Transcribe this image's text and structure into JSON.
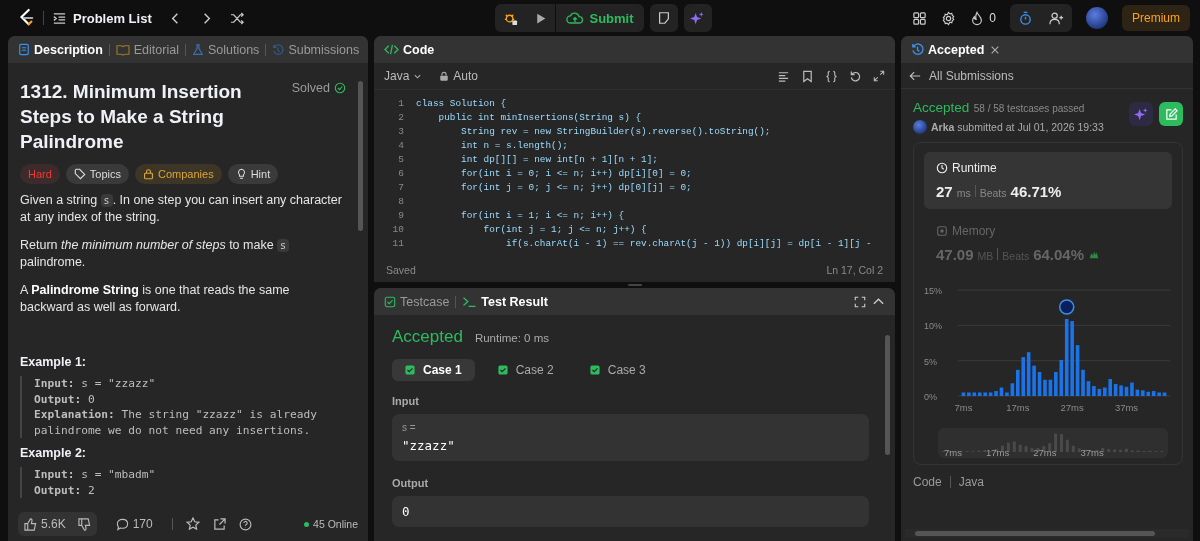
{
  "topbar": {
    "title": "Problem List",
    "submit": "Submit",
    "streak": "0",
    "premium": "Premium"
  },
  "description_panel": {
    "tabs": [
      {
        "label": "Description",
        "selected": true,
        "kind": "description"
      },
      {
        "label": "Editorial",
        "selected": false,
        "kind": "editorial"
      },
      {
        "label": "Solutions",
        "selected": false,
        "kind": "solutions"
      },
      {
        "label": "Submissions",
        "selected": false,
        "kind": "submissions"
      }
    ],
    "title": "1312. Minimum Insertion Steps to Make a String Palindrome",
    "status": "Solved",
    "tags": [
      {
        "label": "Hard",
        "kind": "difficulty"
      },
      {
        "label": "Topics",
        "kind": "topics"
      },
      {
        "label": "Companies",
        "kind": "companies"
      },
      {
        "label": "Hint",
        "kind": "hint"
      }
    ],
    "paragraphs": [
      [
        {
          "kind": "text",
          "text": "Given a string "
        },
        {
          "kind": "code",
          "text": "s"
        },
        {
          "kind": "text",
          "text": ". In one step you can insert any character at any index of the string."
        }
      ],
      [
        {
          "kind": "text",
          "text": "Return "
        },
        {
          "kind": "italic",
          "text": "the minimum number of steps"
        },
        {
          "kind": "text",
          "text": " to make "
        },
        {
          "kind": "code",
          "text": "s"
        },
        {
          "kind": "text",
          "text": " palindrome."
        }
      ],
      [
        {
          "kind": "text",
          "text": "A "
        },
        {
          "kind": "bold",
          "text": "Palindrome String"
        },
        {
          "kind": "text",
          "text": " is one that reads the same backward as well as forward."
        }
      ]
    ],
    "examples": [
      {
        "title": "Example 1:",
        "lines": [
          "**Input:** s = \"zzazz\"",
          "**Output:** 0",
          "**Explanation:** The string \"zzazz\" is already palindrome we do not need any insertions."
        ]
      },
      {
        "title": "Example 2:",
        "lines": [
          "**Input:** s = \"mbadm\"",
          "**Output:** 2"
        ]
      }
    ],
    "footer": {
      "likes": "5.6K",
      "comments": "170",
      "online": "45 Online"
    }
  },
  "code_panel": {
    "title": "Code",
    "language": "Java",
    "mode": "Auto",
    "lines": [
      {
        "number": "1",
        "text": "class Solution {"
      },
      {
        "number": "2",
        "text": "    public int minInsertions(String s) {"
      },
      {
        "number": "3",
        "text": "        String rev = new StringBuilder(s).reverse().toString();"
      },
      {
        "number": "4",
        "text": "        int n = s.length();"
      },
      {
        "number": "5",
        "text": "        int dp[][] = new int[n + 1][n + 1];"
      },
      {
        "number": "6",
        "text": "        for(int i = 0; i <= n; i++) dp[i][0] = 0;"
      },
      {
        "number": "7",
        "text": "        for(int j = 0; j <= n; j++) dp[0][j] = 0;"
      },
      {
        "number": "8"
      },
      {
        "number": "9",
        "text": "        for(int i = 1; i <= n; i++) {"
      },
      {
        "number": "10",
        "text": "            for(int j = 1; j <= n; j++) {"
      },
      {
        "number": "11",
        "text": "                if(s.charAt(i - 1) == rev.charAt(j - 1)) dp[i][j] = dp[i - 1][j -"
      }
    ],
    "status": "Saved",
    "cursor": "Ln 17, Col 2"
  },
  "test_panel": {
    "tabs": [
      {
        "label": "Testcase",
        "selected": false
      },
      {
        "label": "Test Result",
        "selected": true
      }
    ],
    "result": "Accepted",
    "runtime": "Runtime: 0 ms",
    "cases": [
      {
        "label": "Case 1",
        "selected": true
      },
      {
        "label": "Case 2",
        "selected": false
      },
      {
        "label": "Case 3",
        "selected": false
      }
    ],
    "input": {
      "label": "Input",
      "name": "s =",
      "value": "\"zzazz\""
    },
    "output": {
      "label": "Output",
      "value": "0"
    }
  },
  "submission_panel": {
    "tab": "Accepted",
    "back": "All Submissions",
    "status": "Accepted",
    "passed": "58 / 58 testcases passed",
    "submitted": "**Arka** submitted at Jul 01, 2026 19:33",
    "metrics": [
      {
        "label": "Runtime",
        "kind": "runtime",
        "value": "27",
        "unit": "ms",
        "beats_label": "Beats",
        "beats": "46.71%",
        "selected": true
      },
      {
        "label": "Memory",
        "kind": "memory",
        "value": "47.09",
        "unit": "MB",
        "beats_label": "Beats",
        "beats": "64.04%",
        "selected": false
      }
    ],
    "chart_data": {
      "type": "bar",
      "x": [
        7,
        8,
        9,
        10,
        11,
        12,
        13,
        14,
        15,
        16,
        17,
        18,
        19,
        20,
        21,
        22,
        23,
        24,
        25,
        26,
        27,
        28,
        29,
        30,
        31,
        32,
        33,
        34,
        35,
        36,
        37,
        38,
        39,
        40,
        41,
        42,
        43,
        44
      ],
      "values": [
        0.5,
        0.5,
        0.5,
        0.5,
        0.5,
        0.5,
        0.7,
        1.2,
        0.5,
        1.8,
        3.7,
        5.5,
        6.2,
        4.3,
        3.4,
        2.3,
        2.3,
        3.4,
        5.1,
        10.9,
        10.6,
        7.2,
        3.7,
        2.1,
        1.4,
        1.0,
        1.2,
        2.4,
        1.7,
        1.5,
        1.3,
        1.9,
        0.9,
        0.8,
        0.6,
        0.7,
        0.5,
        0.5
      ],
      "xlim": [
        6,
        45
      ],
      "ylim": [
        0,
        15
      ],
      "yticks": [
        {
          "value": 0,
          "label": "0%"
        },
        {
          "value": 5,
          "label": "5%"
        },
        {
          "value": 10,
          "label": "10%"
        },
        {
          "value": 15,
          "label": "15%"
        }
      ],
      "xticks": [
        {
          "value": 7,
          "label": "7ms"
        },
        {
          "value": 17,
          "label": "17ms"
        },
        {
          "value": 27,
          "label": "27ms"
        },
        {
          "value": 37,
          "label": "37ms"
        }
      ]
    },
    "navigator_labels": [
      "7ms",
      "17ms",
      "27ms",
      "37ms"
    ],
    "code_label": "Code",
    "code_language": "Java"
  }
}
